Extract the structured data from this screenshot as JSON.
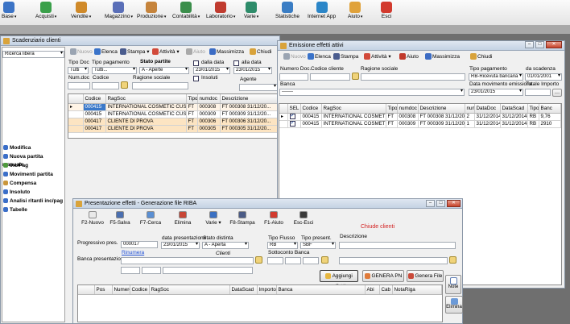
{
  "toolbar": {
    "items": [
      {
        "label": "Base",
        "color": "#3c74c6",
        "dropdown": true
      },
      {
        "label": "Acquisti",
        "color": "#3aa04a",
        "dropdown": true
      },
      {
        "label": "Vendite",
        "color": "#d08a2a",
        "dropdown": true
      },
      {
        "label": "Magazzino",
        "color": "#5a6fb8",
        "dropdown": true
      },
      {
        "label": "Produzione",
        "color": "#c6843c",
        "dropdown": true
      },
      {
        "label": "Contabilità",
        "color": "#3b8e4b",
        "dropdown": true
      },
      {
        "label": "Laboratorio",
        "color": "#c03b2f",
        "dropdown": true
      },
      {
        "label": "Varie",
        "color": "#2e8c6a",
        "dropdown": true
      },
      {
        "label": "Statistiche",
        "color": "#3a7dc4",
        "dropdown": false
      },
      {
        "label": "Internet App",
        "color": "#2b86c8",
        "dropdown": false
      },
      {
        "label": "Aiuto",
        "color": "#e0a23b",
        "dropdown": true
      },
      {
        "label": "Esci",
        "color": "#d23a2e",
        "dropdown": false
      }
    ]
  },
  "scadenziario": {
    "title": "Scadenziario clienti",
    "search_combo": "Ricerca libera",
    "toolbar": {
      "nuovo": "Nuovo",
      "elenca": "Elenca",
      "stampa": "Stampa",
      "attivita": "Attività",
      "aiuto": "Aiuto",
      "massimizza": "Massimizza",
      "chiudi": "Chiudi"
    },
    "filters": {
      "tipo_doc_label": "Tipo Doc",
      "tipo_doc_value": "Tutti",
      "tipo_pagamento_label": "Tipo pagamento",
      "tipo_pagamento_value": "Tutti...",
      "stato_partite_label": "Stato partite",
      "stato_partite_value": "A - Aperte",
      "dalla_data_label": "dalla data",
      "dalla_data_value": "23/01/2015",
      "alla_data_label": "alla data",
      "alla_data_value": "23/01/2015",
      "num_doc_label": "Num.doc",
      "codice_label": "Codice",
      "ragione_sociale_label": "Ragione sociale",
      "insoluti_label": "Insoluti",
      "agente_label": "Agente"
    },
    "grid": {
      "columns": [
        "Codice",
        "RagSoc",
        "Tipo",
        "numdoc",
        "Descrizione"
      ],
      "rows": [
        {
          "codice": "000415",
          "ragsoc": "INTERNATIONAL COSMETIC CUST...",
          "tipo": "FT",
          "numdoc": "000308",
          "descr": "FT 000308 31/12/20..."
        },
        {
          "codice": "000415",
          "ragsoc": "INTERNATIONAL COSMETIC CUST...",
          "tipo": "FT",
          "numdoc": "000309",
          "descr": "FT 000309 31/12/20..."
        },
        {
          "codice": "000417",
          "ragsoc": "CLIENTE DI PROVA",
          "tipo": "FT",
          "numdoc": "000306",
          "descr": "FT 000306 31/12/20..."
        },
        {
          "codice": "000417",
          "ragsoc": "CLIENTE DI PROVA",
          "tipo": "FT",
          "numdoc": "000305",
          "descr": "FT 000305 31/12/20..."
        }
      ]
    },
    "menu": [
      {
        "label": "Modifica",
        "color": "#3a6ec8"
      },
      {
        "label": "Nuova partita manuale",
        "color": "#3a6ec8"
      },
      {
        "label": "Inc/Pag",
        "color": "#4f9a3e"
      },
      {
        "label": "Movimenti partita",
        "color": "#3a6ec8"
      },
      {
        "label": "Compensa",
        "color": "#c9963b"
      },
      {
        "label": "Insoluto",
        "color": "#3a6ec8"
      },
      {
        "label": "Analisi ritardi inc/pag",
        "color": "#3a6ec8"
      },
      {
        "label": "Tabelle",
        "color": "#3a6ec8"
      }
    ]
  },
  "emissione": {
    "title": "Emissione effetti attivi",
    "toolbar": {
      "nuovo": "Nuovo",
      "elenca": "Elenca",
      "stampa": "Stampa",
      "attivita": "Attività",
      "aiuto": "Aiuto",
      "massimizza": "Massimizza",
      "chiudi": "Chiudi"
    },
    "fields": {
      "numero_doc_label": "Numero Doc.",
      "codice_cliente_label": "Codice cliente",
      "ragione_sociale_label": "Ragione sociale",
      "tipo_pagamento_label": "Tipo pagamento",
      "tipo_pagamento_value": "RB-Ricevuta bancaria",
      "da_scadenza_label": "da scadenza",
      "da_scadenza_value": "01/01/2001",
      "banca_label": "Banca",
      "banca_value": "-------",
      "data_mov_label": "Data movimento emissione",
      "data_mov_value": "23/01/2015",
      "totale_importo_label": "Totale Importo"
    },
    "grid": {
      "columns": [
        "SEL",
        "Codice",
        "RagSoc",
        "Tipo",
        "numdoc",
        "Descrizione",
        "numi",
        "DataDoc",
        "DataScad",
        "Tipo",
        "Banc"
      ],
      "rows": [
        {
          "sel": true,
          "codice": "000415",
          "ragsoc": "INTERNATIONAL COSMETI...",
          "tipo": "FT",
          "numdoc": "000308",
          "descr": "FT 000308 31/12/20...",
          "numi": "2",
          "datadoc": "31/12/2014",
          "datascad": "31/12/2014",
          "tipo2": "RB",
          "banc": "9,76"
        },
        {
          "sel": true,
          "codice": "000415",
          "ragsoc": "INTERNATIONAL COSMETI...",
          "tipo": "FT",
          "numdoc": "000309",
          "descr": "FT 000309 31/12/20...",
          "numi": "1",
          "datadoc": "31/12/2014",
          "datascad": "31/12/2014",
          "tipo2": "RB",
          "banc": "2910"
        }
      ]
    }
  },
  "presentazione": {
    "title": "Presentazione effetti - Generazione file RIBA",
    "toolbar": {
      "nuovo": "F2-Nuovo",
      "salva": "F5-Salva",
      "cerca": "F7-Cerca",
      "elimina": "Elimina",
      "varie": "Varie",
      "stampa": "F8-Stampa",
      "aiuto": "F1-Aiuto",
      "esci": "Esc-Esci"
    },
    "chiude_clienti": "Chiude clienti",
    "fields": {
      "progressivo_label": "Progressivo pres.",
      "progressivo_value": "000017",
      "data_label": "data presentazione",
      "data_value": "23/01/2015",
      "stato_label": "Stato distinta",
      "stato_value": "A - Aperta",
      "tipo_flusso_label": "Tipo Flusso",
      "tipo_flusso_value": "RB",
      "tipo_present_label": "Tipo present.",
      "tipo_present_value": "SBF",
      "descrizione_label": "Descrizione",
      "rinumera": "Rinumera",
      "clienti": "Clienti",
      "banca_label": "Banca presentazione",
      "sottoconto_label": "Sottoconto Banca"
    },
    "buttons": {
      "aggiungi": "Aggiungi effetti",
      "genera_pn": "GENERA PN",
      "genera_file": "Genera File"
    },
    "grid": {
      "columns": [
        "Pos",
        "Numero",
        "Codice",
        "RagSoc",
        "DataScad",
        "Importo",
        "Banca",
        "Abi",
        "Cab",
        "NotaRiga"
      ]
    },
    "side": {
      "note": "Note",
      "elimina": "Elimina"
    }
  }
}
